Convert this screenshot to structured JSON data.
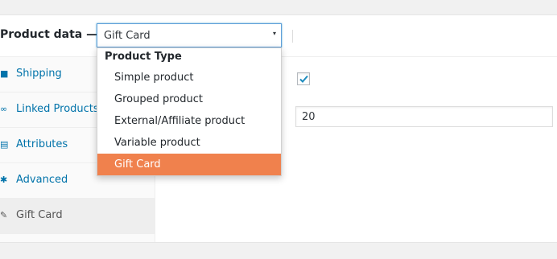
{
  "header": {
    "label": "Product data —",
    "select_value": "Gift Card",
    "select_caret": "▾"
  },
  "tabs": [
    {
      "label": "Shipping",
      "icon": "truck-icon",
      "glyph": "■"
    },
    {
      "label": "Linked Products",
      "icon": "link-icon",
      "glyph": "∞"
    },
    {
      "label": "Attributes",
      "icon": "list-icon",
      "glyph": "▤"
    },
    {
      "label": "Advanced",
      "icon": "gear-icon",
      "glyph": "✱"
    },
    {
      "label": "Gift Card",
      "icon": "wrench-icon",
      "glyph": "✎",
      "active": true
    }
  ],
  "content": {
    "partial_label": ":",
    "checkbox_checked": true,
    "input_value": "20"
  },
  "dropdown": {
    "group_label": "Product Type",
    "options": [
      {
        "label": "Simple product"
      },
      {
        "label": "Grouped product"
      },
      {
        "label": "External/Affiliate product"
      },
      {
        "label": "Variable product"
      },
      {
        "label": "Gift Card",
        "selected": true
      }
    ]
  },
  "colors": {
    "accent_link": "#0073aa",
    "selected_option": "#f0814d",
    "focus_border": "#5b9dd9"
  }
}
